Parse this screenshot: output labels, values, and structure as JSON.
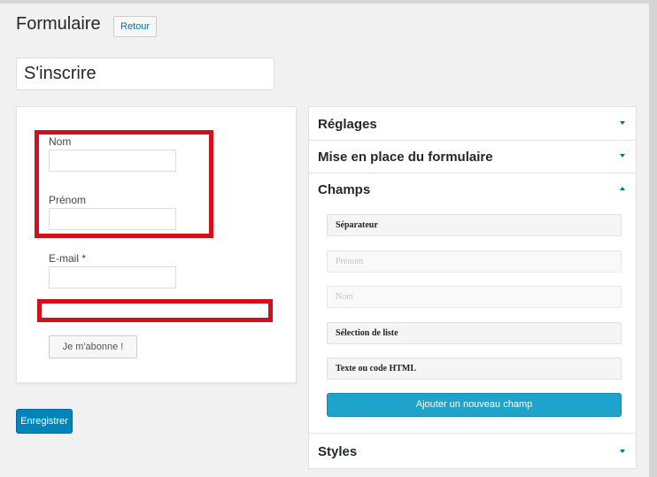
{
  "header": {
    "title": "Formulaire",
    "back_label": "Retour"
  },
  "form_title": "S'inscrire",
  "preview": {
    "fields": [
      {
        "label": "Nom"
      },
      {
        "label": "Prénom"
      },
      {
        "label": "E-mail *"
      }
    ],
    "submit_label": "Je m'abonne !"
  },
  "save_label": "Enregistrer",
  "sections": {
    "reglages": "Réglages",
    "mise_en_place": "Mise en place du formulaire",
    "champs": "Champs",
    "styles": "Styles"
  },
  "champs": {
    "items": [
      {
        "label": "Séparateur",
        "enabled": true
      },
      {
        "label": "Prénom",
        "enabled": false
      },
      {
        "label": "Nom",
        "enabled": false
      },
      {
        "label": "Sélection de liste",
        "enabled": true
      },
      {
        "label": "Texte ou code HTML",
        "enabled": true
      }
    ],
    "add_label": "Ajouter un nouveau champ"
  },
  "colors": {
    "accent": "#0085ba",
    "highlight": "#d20f1d"
  }
}
